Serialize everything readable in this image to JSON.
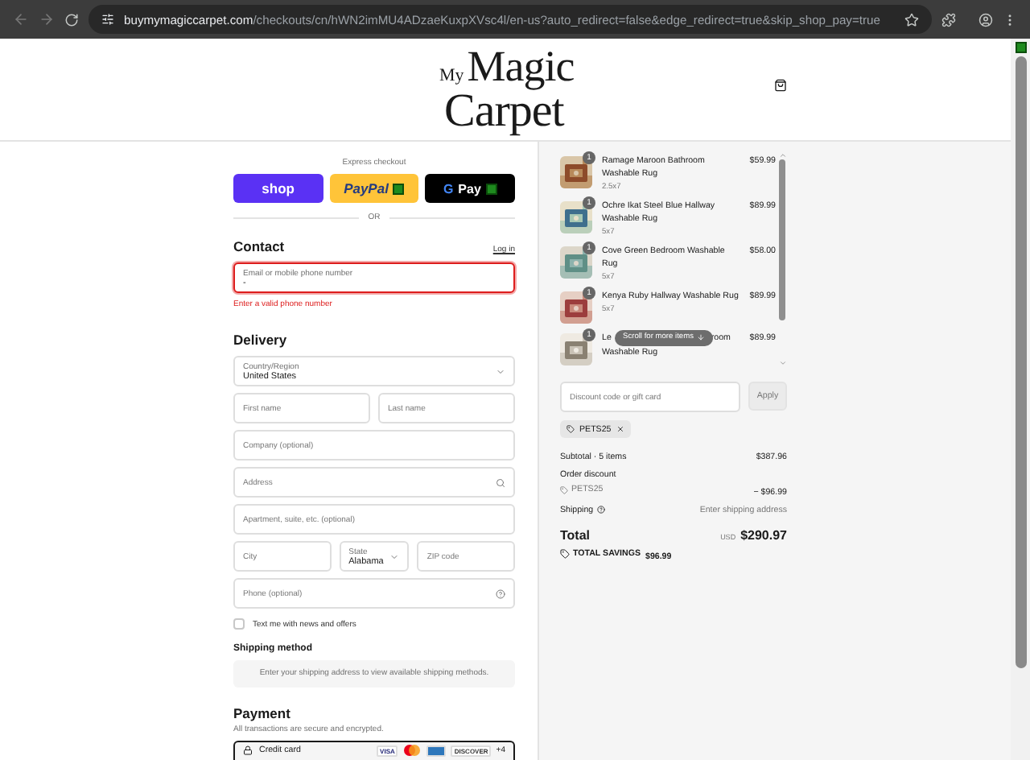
{
  "browser": {
    "url_host": "buymymagiccarpet.com",
    "url_path": "/checkouts/cn/hWN2imMU4ADzaeKuxpXVsc4l/en-us?auto_redirect=false&edge_redirect=true&skip_shop_pay=true"
  },
  "logo": {
    "small": "My",
    "line1": "Magic",
    "line2": "Carpet"
  },
  "express": {
    "title": "Express checkout",
    "buttons": [
      {
        "kind": "shop",
        "label": "shop"
      },
      {
        "kind": "paypal",
        "label": "PayPal"
      },
      {
        "kind": "gpay",
        "label": "Pay",
        "g": "G"
      }
    ],
    "divider": "OR"
  },
  "contact": {
    "title": "Contact",
    "login": "Log in",
    "field": {
      "label": "Email or mobile phone number",
      "value": "-",
      "invalid": true
    },
    "error": "Enter a valid phone number"
  },
  "delivery": {
    "title": "Delivery",
    "country": {
      "label": "Country/Region",
      "value": "United States"
    },
    "first_name": {
      "placeholder": "First name"
    },
    "last_name": {
      "placeholder": "Last name"
    },
    "company": {
      "placeholder": "Company (optional)"
    },
    "address": {
      "placeholder": "Address"
    },
    "apartment": {
      "placeholder": "Apartment, suite, etc. (optional)"
    },
    "city": {
      "placeholder": "City"
    },
    "state": {
      "label": "State",
      "value": "Alabama"
    },
    "zip": {
      "placeholder": "ZIP code"
    },
    "phone": {
      "placeholder": "Phone (optional)"
    },
    "sms": {
      "label": "Text me with news and offers",
      "checked": false
    }
  },
  "shipping": {
    "title": "Shipping method",
    "note": "Enter your shipping address to view available shipping methods."
  },
  "payment": {
    "title": "Payment",
    "note": "All transactions are secure and encrypted.",
    "method": "Credit card",
    "cards": [
      {
        "kind": "visa",
        "label": "VISA"
      },
      {
        "kind": "mastercard"
      },
      {
        "kind": "amex"
      },
      {
        "kind": "discover",
        "label": "DISCOVER"
      }
    ],
    "more": "+4"
  },
  "items": [
    {
      "qty": "1",
      "name": "Ramage Maroon Bathroom Washable Rug",
      "size": "2.5x7",
      "price": "$59.99"
    },
    {
      "qty": "1",
      "name": "Ochre Ikat Steel Blue Hallway Washable Rug",
      "size": "5x7",
      "price": "$89.99"
    },
    {
      "qty": "1",
      "name": "Cove Green Bedroom Washable Rug",
      "size": "5x7",
      "price": "$58.00"
    },
    {
      "qty": "1",
      "name": "Kenya Ruby Hallway Washable Rug",
      "size": "5x7",
      "price": "$89.99"
    },
    {
      "qty": "1",
      "name_parts": [
        "Le",
        "room"
      ],
      "name_line2": "Washable Rug",
      "price": "$89.99"
    }
  ],
  "scroll_hint": "Scroll for more items",
  "discount": {
    "placeholder": "Discount code or gift card",
    "apply": "Apply",
    "code": "PETS25"
  },
  "summary": {
    "subtotal_label": "Subtotal · 5 items",
    "subtotal": "$387.96",
    "order_discount": "Order discount",
    "code": "PETS25",
    "discount": "− $96.99",
    "shipping_label": "Shipping",
    "shipping": "Enter shipping address",
    "total_label": "Total",
    "currency": "USD",
    "total": "$290.97",
    "savings_label": "TOTAL SAVINGS",
    "savings": "$96.99"
  }
}
